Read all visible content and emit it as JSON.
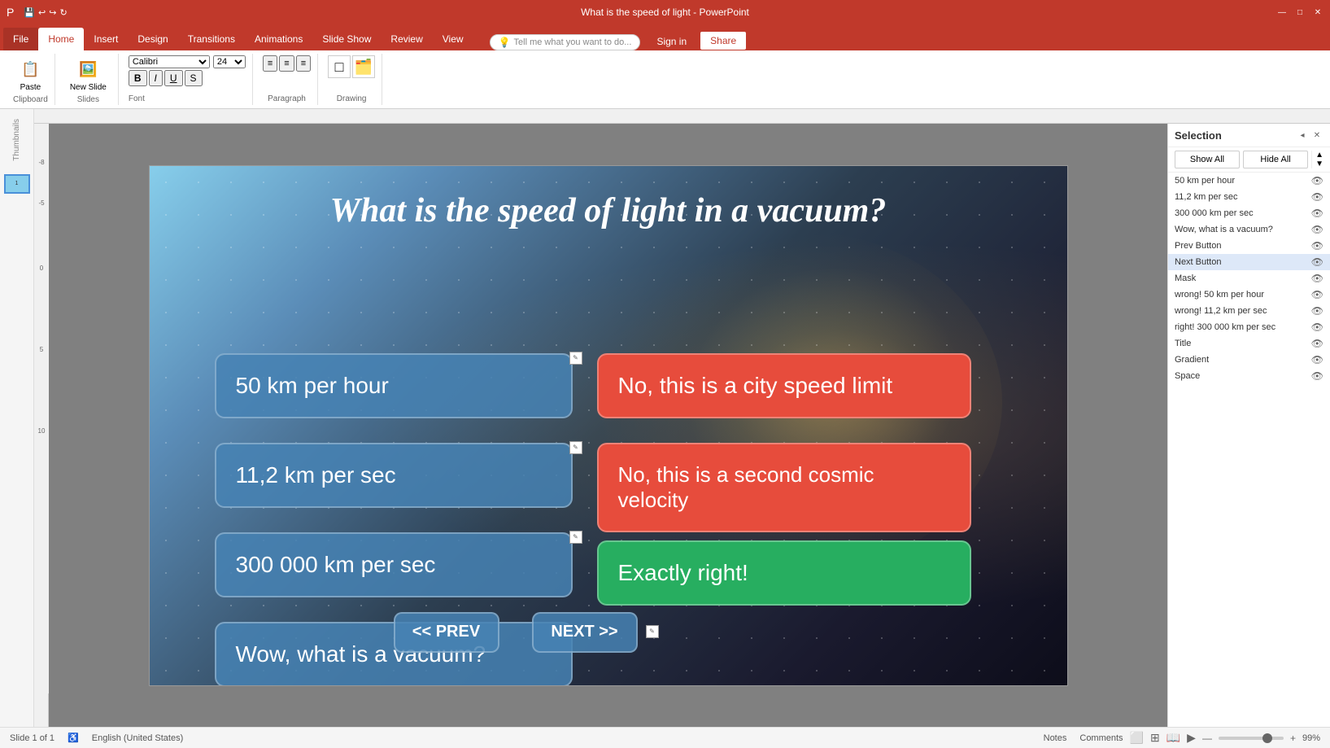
{
  "window": {
    "title": "What is the speed of light - PowerPoint",
    "min_btn": "—",
    "max_btn": "□",
    "close_btn": "✕"
  },
  "ribbon": {
    "tabs": [
      "File",
      "Home",
      "Insert",
      "Design",
      "Transitions",
      "Animations",
      "Slide Show",
      "Review",
      "View"
    ],
    "active_tab": "Home",
    "tell_me": "Tell me what you want to do...",
    "sign_in": "Sign in",
    "share": "Share"
  },
  "slide": {
    "title": "What is the speed of light in a vacuum?",
    "choices": [
      {
        "id": 1,
        "text": "50 km per hour"
      },
      {
        "id": 2,
        "text": "11,2 km per sec"
      },
      {
        "id": 3,
        "text": "300 000 km per sec"
      },
      {
        "id": 4,
        "text": "Wow, what is a vacuum?"
      }
    ],
    "feedbacks": [
      {
        "id": 1,
        "text": "No, this is a city speed limit",
        "color": "red"
      },
      {
        "id": 2,
        "text": "No, this is a second cosmic velocity",
        "color": "red"
      },
      {
        "id": 3,
        "text": "Exactly right!",
        "color": "green"
      }
    ],
    "prev_btn": "<< PREV",
    "next_btn": "NEXT >>"
  },
  "selection_panel": {
    "title": "Selection",
    "show_all": "Show All",
    "hide_all": "Hide All",
    "items": [
      {
        "label": "50 km per hour"
      },
      {
        "label": "11,2 km per sec"
      },
      {
        "label": "300 000 km per sec"
      },
      {
        "label": "Wow, what is a vacuum?"
      },
      {
        "label": "Prev Button"
      },
      {
        "label": "Next Button"
      },
      {
        "label": "Mask"
      },
      {
        "label": "wrong! 50 km per hour"
      },
      {
        "label": "wrong! 11,2 km per sec"
      },
      {
        "label": "right! 300 000 km per sec"
      },
      {
        "label": "Title"
      },
      {
        "label": "Gradient"
      },
      {
        "label": "Space"
      }
    ]
  },
  "status_bar": {
    "slide_info": "Slide 1 of 1",
    "language": "English (United States)",
    "notes": "Notes",
    "comments": "Comments",
    "zoom_pct": "99%"
  }
}
